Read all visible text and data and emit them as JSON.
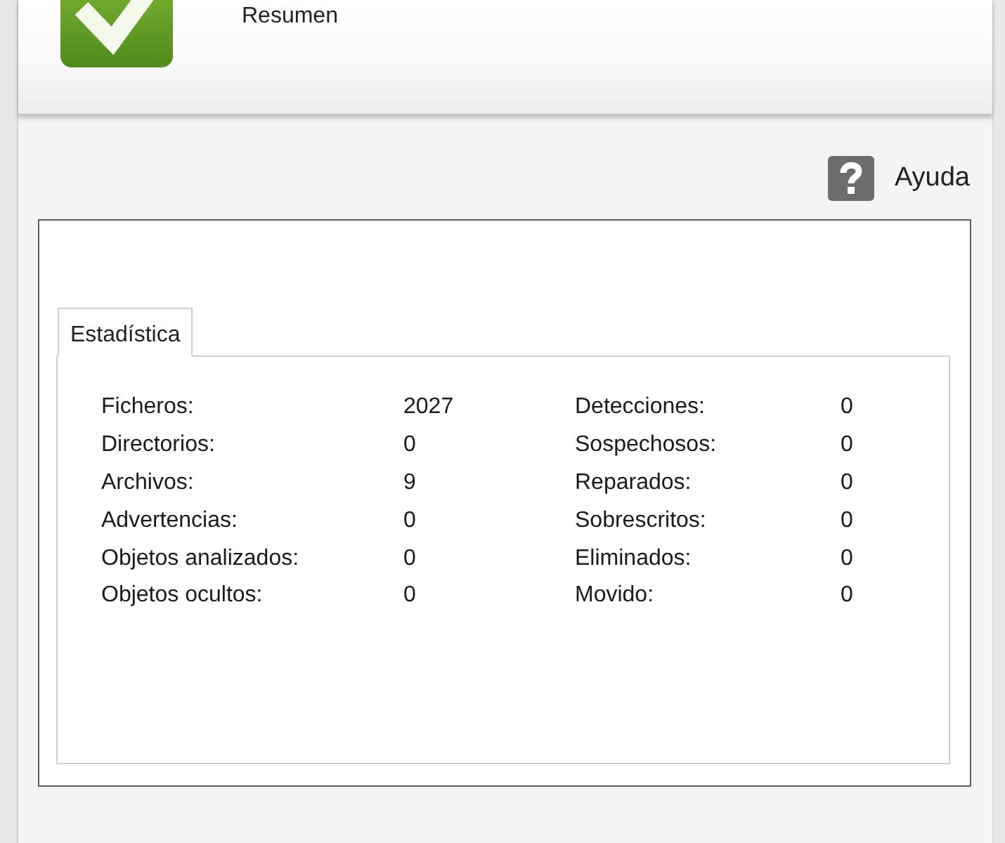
{
  "header": {
    "title": "Resumen"
  },
  "help": {
    "label": "Ayuda"
  },
  "tabs": [
    {
      "label": "Estadística",
      "selected": true
    }
  ],
  "stats": {
    "left": [
      {
        "label": "Ficheros:",
        "value": "2027"
      },
      {
        "label": "Directorios:",
        "value": "0"
      },
      {
        "label": "Archivos:",
        "value": "9"
      },
      {
        "label": "Advertencias:",
        "value": "0"
      },
      {
        "label": "Objetos analizados:",
        "value": "0"
      },
      {
        "label": "Objetos ocultos:",
        "value": "0"
      }
    ],
    "right": [
      {
        "label": "Detecciones:",
        "value": "0"
      },
      {
        "label": "Sospechosos:",
        "value": "0"
      },
      {
        "label": "Reparados:",
        "value": "0"
      },
      {
        "label": "Sobrescritos:",
        "value": "0"
      },
      {
        "label": "Eliminados:",
        "value": "0"
      },
      {
        "label": "Movido:",
        "value": "0"
      }
    ]
  }
}
